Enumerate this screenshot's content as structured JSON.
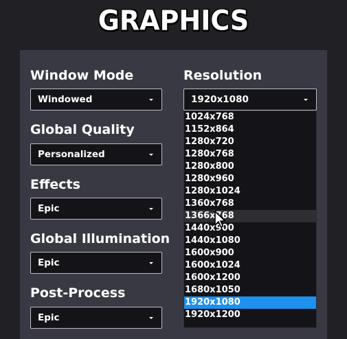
{
  "title": "GRAPHICS",
  "settings": {
    "window_mode": {
      "label": "Window Mode",
      "value": "Windowed"
    },
    "global_quality": {
      "label": "Global Quality",
      "value": "Personalized"
    },
    "effects": {
      "label": "Effects",
      "value": "Epic"
    },
    "global_illumination": {
      "label": "Global Illumination",
      "value": "Epic"
    },
    "post_process": {
      "label": "Post-Process",
      "value": "Epic"
    },
    "resolution": {
      "label": "Resolution",
      "value": "1920x1080"
    }
  },
  "resolution_options": [
    "1024x768",
    "1152x864",
    "1280x720",
    "1280x768",
    "1280x800",
    "1280x960",
    "1280x1024",
    "1360x768",
    "1366x768",
    "1440x900",
    "1440x1080",
    "1600x900",
    "1600x1024",
    "1600x1200",
    "1680x1050",
    "1920x1080",
    "1920x1200"
  ],
  "hovered_option": "1366x768",
  "selected_option": "1920x1080",
  "colors": {
    "background": "#212125",
    "panel": "#393944",
    "dropdown": "#141418",
    "selected": "#1e90ee",
    "hover": "#2e2e33"
  },
  "icons": {
    "dropdown_arrow": "chevron-down-icon",
    "cursor": "mouse-pointer-icon"
  }
}
